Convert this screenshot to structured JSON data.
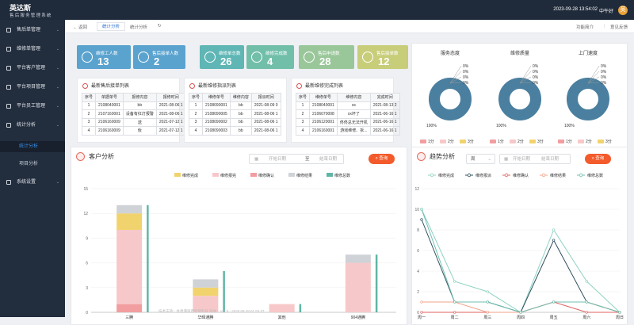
{
  "header": {
    "brand": "英达斯",
    "subtitle": "售后服务管理系统",
    "datetime": "2023-09-28 13:54:02",
    "greeting": "中午好",
    "avatar": "英"
  },
  "sidebar": {
    "items": [
      {
        "label": "售后单管理",
        "icon": "order-icon"
      },
      {
        "label": "维修单管理",
        "icon": "repair-icon"
      },
      {
        "label": "平台客户管理",
        "icon": "customer-icon"
      },
      {
        "label": "平台项目管理",
        "icon": "project-icon"
      },
      {
        "label": "平台员工管理",
        "icon": "staff-icon"
      },
      {
        "label": "统计分析",
        "icon": "chart-icon"
      },
      {
        "label": "系统设置",
        "icon": "settings-icon"
      }
    ],
    "sub": [
      {
        "label": "统计分析",
        "active": true
      },
      {
        "label": "项目分析",
        "active": false
      }
    ]
  },
  "breadbar": {
    "back": "← 返回",
    "tab": "统计分析",
    "current": "统计分析",
    "right1": "功能简介",
    "right2": "意见反馈"
  },
  "stats": [
    {
      "label": "维修工人数",
      "value": "13",
      "icon": "workers-icon",
      "color": "#5aa3cf"
    },
    {
      "label": "售后接单人数",
      "value": "2",
      "icon": "person-icon",
      "color": "#5aa3cf"
    },
    {
      "label": "维修单总数",
      "value": "26",
      "icon": "doc-icon",
      "color": "#5fb6b5"
    },
    {
      "label": "维修完成数",
      "value": "4",
      "icon": "check-icon",
      "color": "#72bfa9"
    },
    {
      "label": "售后申请数",
      "value": "28",
      "icon": "clock-icon",
      "color": "#9ac79a"
    },
    {
      "label": "售后接单数",
      "value": "12",
      "icon": "list-icon",
      "color": "#c8cd7a"
    }
  ],
  "tables": [
    {
      "title": "最新售后接单列表",
      "headers": [
        "序号",
        "单据单号",
        "报修内容",
        "报修时间"
      ],
      "rows": [
        [
          "1",
          "2108040001",
          "bb",
          "2021-08-06 1"
        ],
        [
          "2",
          "2107160001",
          "设备有红灯报警",
          "2021-08-06 1"
        ],
        [
          "3",
          "2106160009",
          "送",
          "2021-07-12 1"
        ],
        [
          "4",
          "2106160009",
          "仮",
          "2021-07-12 1"
        ]
      ]
    },
    {
      "title": "最新维修指派列表",
      "headers": [
        "序号",
        "维修单号",
        "维修内容",
        "报派时间"
      ],
      "rows": [
        [
          "1",
          "2108090001",
          "bb",
          "2021-08-09 0"
        ],
        [
          "2",
          "2108090005",
          "bb",
          "2021-08-06 1"
        ],
        [
          "3",
          "2108090002",
          "bb",
          "2021-08-06 1"
        ],
        [
          "4",
          "2108090003",
          "bb",
          "2021-08-06 1"
        ]
      ]
    },
    {
      "title": "最新维修完成列表",
      "headers": [
        "序号",
        "维修单号",
        "维修内容",
        "完成时间"
      ],
      "rows": [
        [
          "1",
          "2108040001",
          "ss",
          "2021-08-13 2"
        ],
        [
          "2",
          "2106070008",
          "xx坏了",
          "2021-06-16 1"
        ],
        [
          "3",
          "2106120001",
          "佟佟总无法开机",
          "2021-06-16 1"
        ],
        [
          "4",
          "2106160001",
          "游戏维修、拆...",
          "2021-06-16 1"
        ]
      ]
    }
  ],
  "donuts": [
    {
      "title": "服务态度",
      "top_label": "100%",
      "zero_labels": [
        "0%",
        "0%",
        "0%",
        "0%"
      ]
    },
    {
      "title": "维修质量",
      "top_label": "100%",
      "zero_labels": [
        "0%",
        "0%",
        "0%",
        "0%"
      ]
    },
    {
      "title": "上门速度",
      "top_label": "100%",
      "zero_labels": [
        "0%",
        "0%",
        "0%",
        "0%"
      ]
    }
  ],
  "donut_legend": [
    {
      "label": "1分",
      "color": "#f29ea0"
    },
    {
      "label": "2分",
      "color": "#f7c8c9"
    },
    {
      "label": "3分",
      "color": "#f1d36e"
    },
    {
      "label": "4分",
      "color": "#cfd2d7"
    },
    {
      "label": "5分",
      "color": "#4a7f9f"
    }
  ],
  "customer": {
    "title": "客户分析",
    "start_placeholder": "开始日期",
    "to": "至",
    "end_placeholder": "结束日期",
    "query": "查询",
    "chart_data": {
      "type": "bar",
      "categories": [
        "三腾",
        "华晖通腾",
        "其他",
        "904通腾"
      ],
      "series": [
        {
          "name": "维修完成",
          "color": "#f1d36e",
          "values": [
            2,
            1,
            0,
            0
          ]
        },
        {
          "name": "维修报完",
          "color": "#f7c8c9",
          "values": [
            9,
            2,
            1,
            6
          ]
        },
        {
          "name": "维修确认",
          "color": "#f29ea0",
          "values": [
            1,
            0,
            0,
            0
          ]
        },
        {
          "name": "维修结果",
          "color": "#cfd2d7",
          "values": [
            1,
            1,
            0,
            1
          ]
        },
        {
          "name": "维修总数",
          "color": "#5fb6a5",
          "values": [
            13,
            5,
            1,
            7
          ]
        }
      ],
      "ylim": [
        0,
        15
      ],
      "yticks": [
        0,
        3,
        6,
        9,
        12,
        15
      ]
    }
  },
  "trend": {
    "title": "趋势分析",
    "period": "周",
    "start_placeholder": "开始日期",
    "end_placeholder": "结束日期",
    "query": "查询",
    "chart_data": {
      "type": "line",
      "categories": [
        "周一",
        "周二",
        "周三",
        "周四",
        "周五",
        "周六",
        "周日"
      ],
      "series": [
        {
          "name": "维修完成",
          "color": "#8fd3c3",
          "values": [
            10,
            3,
            2,
            0,
            8,
            3,
            0
          ]
        },
        {
          "name": "维修报派",
          "color": "#2f4f5f",
          "values": [
            9,
            1,
            1,
            0,
            7,
            1,
            0
          ]
        },
        {
          "name": "维修确认",
          "color": "#e06060",
          "values": [
            0,
            0,
            0,
            0,
            1,
            0,
            0
          ]
        },
        {
          "name": "维修结果",
          "color": "#f2a38a",
          "values": [
            1,
            1,
            0,
            0,
            1,
            1,
            0
          ]
        },
        {
          "name": "维修总数",
          "color": "#6fc0b0",
          "values": [
            10,
            1,
            1,
            0,
            1,
            1,
            0
          ]
        }
      ],
      "ylim": [
        0,
        12
      ],
      "yticks": [
        0,
        2,
        4,
        6,
        8,
        10,
        12
      ]
    }
  },
  "footer": "技术支持：甘肃港恩西智能科技 版本：V 2.0 · 2020.09.28.01.53.37"
}
